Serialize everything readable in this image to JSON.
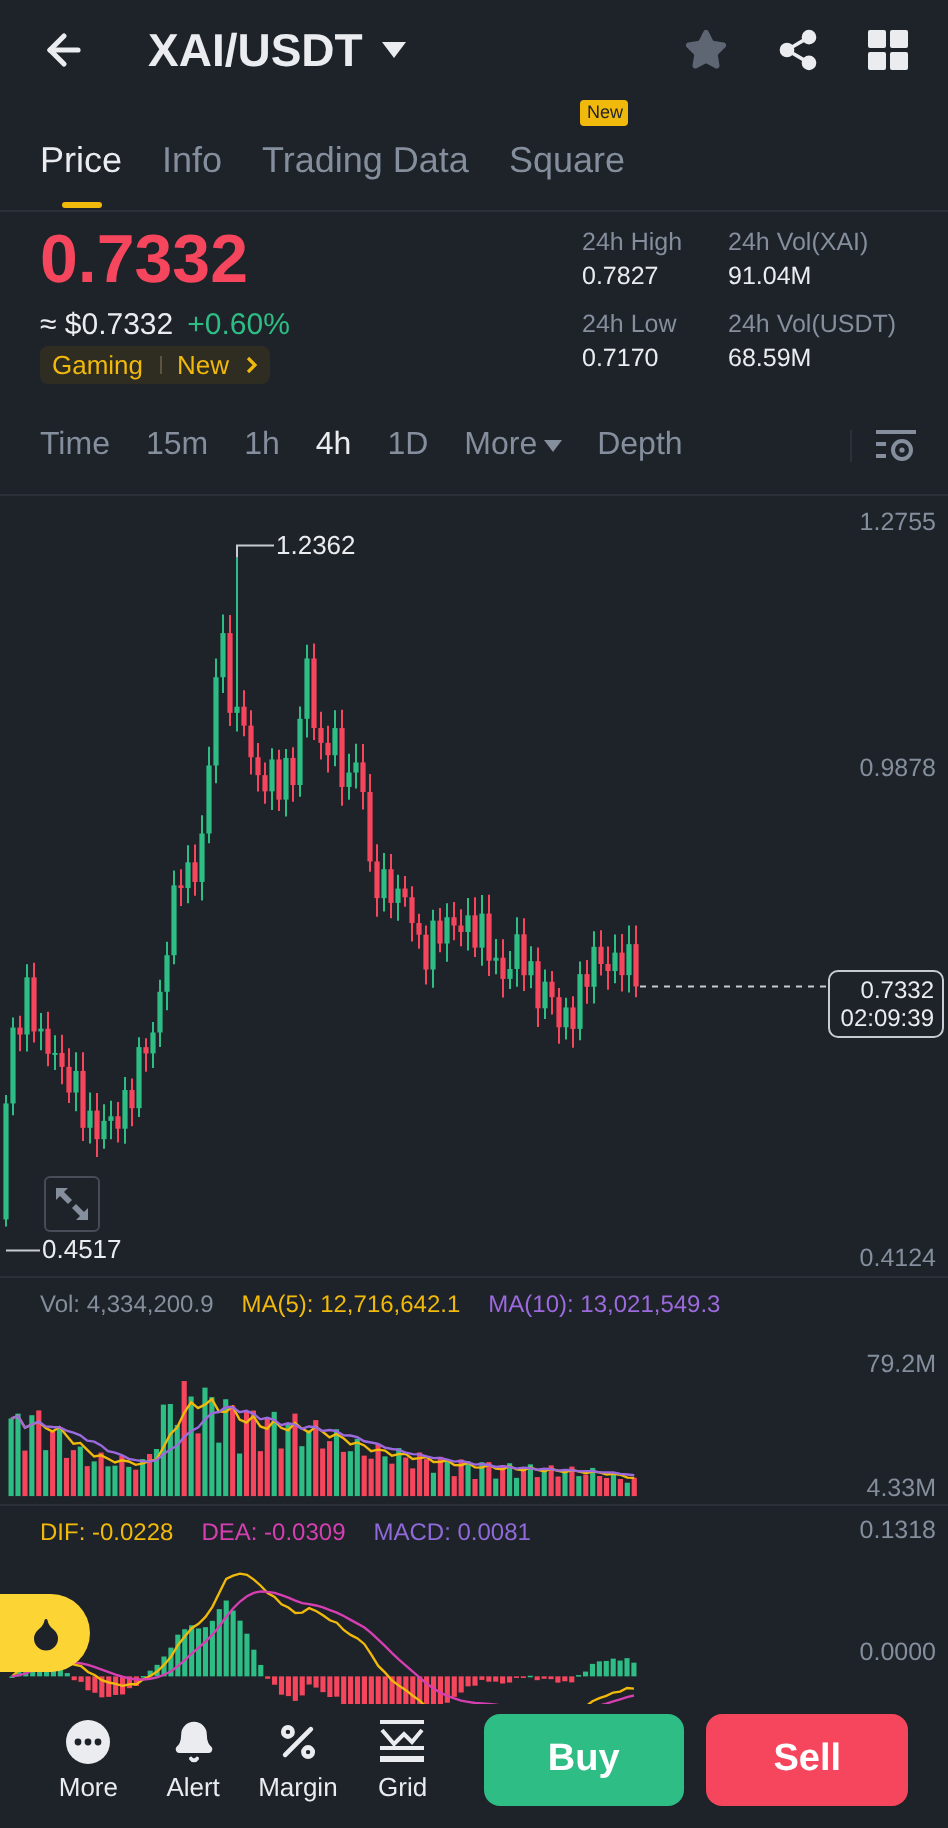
{
  "header": {
    "title": "XAI/USDT"
  },
  "tabs": [
    {
      "label": "Price",
      "selected": true
    },
    {
      "label": "Info",
      "selected": false
    },
    {
      "label": "Trading Data",
      "selected": false
    },
    {
      "label": "Square",
      "selected": false,
      "badge": "New"
    }
  ],
  "price": {
    "last": "0.7332",
    "falling": true,
    "fiat": "≈ $0.7332",
    "change": "+0.60%",
    "change_rising": true,
    "tags": [
      "Gaming",
      "New"
    ]
  },
  "stats": [
    {
      "label": "24h High",
      "value": "0.7827"
    },
    {
      "label": "24h Vol(XAI)",
      "value": "91.04M"
    },
    {
      "label": "24h Low",
      "value": "0.7170"
    },
    {
      "label": "24h Vol(USDT)",
      "value": "68.59M"
    }
  ],
  "intervals": [
    {
      "label": "Time",
      "selected": false
    },
    {
      "label": "15m",
      "selected": false
    },
    {
      "label": "1h",
      "selected": false
    },
    {
      "label": "4h",
      "selected": true
    },
    {
      "label": "1D",
      "selected": false
    },
    {
      "label": "More",
      "selected": false,
      "dropdown": true
    },
    {
      "label": "Depth",
      "selected": false
    }
  ],
  "chart": {
    "price_ticks": [
      "1.2755",
      "0.9878",
      "0.4124"
    ],
    "high_marker": "1.2362",
    "low_marker": "0.4517",
    "last_price": "0.7332",
    "countdown": "02:09:39"
  },
  "volume": {
    "legend": [
      {
        "label": "Vol: 4,334,200.9",
        "color": "#848e9c"
      },
      {
        "label": "MA(5): 12,716,642.1",
        "color": "#f0b90b"
      },
      {
        "label": "MA(10): 13,021,549.3",
        "color": "#9c6ade"
      }
    ],
    "ticks": [
      "79.2M",
      "4.33M"
    ]
  },
  "macd": {
    "legend": [
      {
        "label": "DIF: -0.0228",
        "color": "#f0b90b"
      },
      {
        "label": "DEA: -0.0309",
        "color": "#d63fb1"
      },
      {
        "label": "MACD: 0.0081",
        "color": "#8f6ad8"
      }
    ],
    "ticks": [
      "0.1318",
      "0.0000"
    ]
  },
  "bottom_bar": {
    "actions": [
      "More",
      "Alert",
      "Margin",
      "Grid"
    ],
    "buy": "Buy",
    "sell": "Sell"
  }
}
